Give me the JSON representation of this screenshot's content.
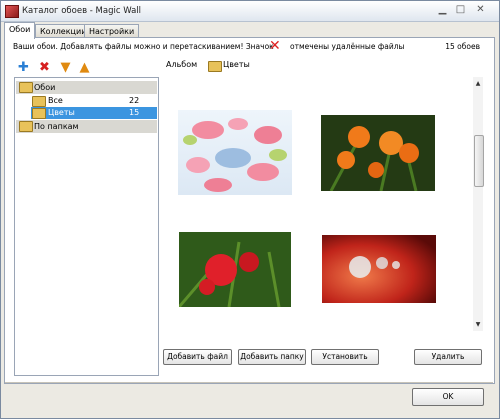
{
  "window": {
    "title": "Каталог обоев - Magic Wall",
    "controls": [
      "minimize-icon",
      "maximize-icon",
      "close-icon"
    ]
  },
  "tabs": [
    {
      "label": "Обои",
      "active": true
    },
    {
      "label": "Коллекции",
      "active": false
    },
    {
      "label": "Настройки",
      "active": false
    }
  ],
  "info": {
    "hint": "Ваши обои. Добавлять файлы можно и перетаскиванием!",
    "mark_label": "Значок",
    "mark_tail": "отмечены удалённые файлы",
    "count": "15 обоев"
  },
  "toolbar": {
    "icons": [
      "add-icon",
      "delete-icon",
      "move-down-icon",
      "move-up-icon"
    ]
  },
  "tree": {
    "groups": [
      {
        "label": "Обои",
        "items": [
          {
            "label": "Все",
            "count": "22",
            "selected": false
          },
          {
            "label": "Цветы",
            "count": "15",
            "selected": true
          }
        ]
      },
      {
        "label": "По папкам",
        "items": []
      }
    ]
  },
  "view_links": {
    "album": "Альбом",
    "current": "Цветы"
  },
  "gallery": {
    "thumbnails": [
      "flower-pattern-thumbnail",
      "orange-lilies-thumbnail",
      "red-lily-thumbnail",
      "water-drop-thumbnail"
    ]
  },
  "buttons": {
    "add_files": "Добавить файл",
    "add_folder": "Добавить папку",
    "set": "Установить",
    "delete": "Удалить",
    "ok": "OK"
  },
  "colors": {
    "selection": "#3b95e0",
    "titlebar": "#dfe6ef"
  }
}
